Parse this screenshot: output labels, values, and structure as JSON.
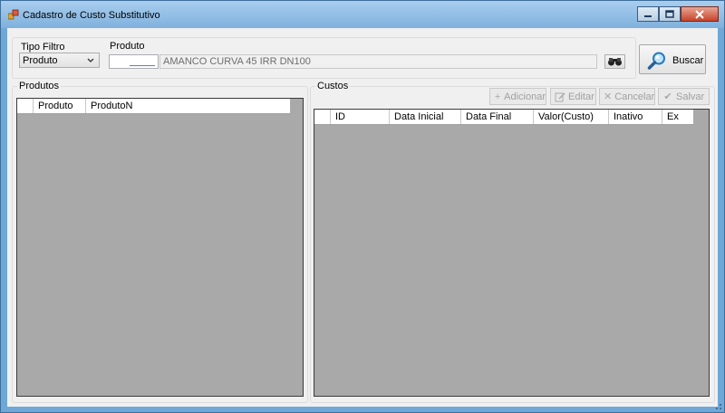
{
  "window": {
    "title": "Cadastro de Custo Substitutivo"
  },
  "filter": {
    "tipo_filtro_label": "Tipo Filtro",
    "tipo_filtro_value": "Produto",
    "produto_label": "Produto",
    "produto_code_value": "",
    "produto_description_value": "AMANCO CURVA 45 IRR DN100",
    "buscar_label": "Buscar"
  },
  "produtos_panel": {
    "title": "Produtos",
    "columns": [
      "",
      "Produto",
      "ProdutoN"
    ]
  },
  "custos_panel": {
    "title": "Custos",
    "toolbar": {
      "adicionar_label": "Adicionar",
      "editar_label": "Editar",
      "cancelar_label": "Cancelar",
      "salvar_label": "Salvar"
    },
    "columns": [
      "",
      "ID",
      "Data Inicial",
      "Data Final",
      "Valor(Custo)",
      "Inativo",
      "Ex"
    ]
  },
  "icons": {
    "app": "app-icon",
    "minimize": "minimize-icon",
    "maximize": "maximize-icon",
    "close": "close-icon",
    "dropdown": "chevron-down-icon",
    "binoculars": "binoculars-icon",
    "search": "magnifier-icon",
    "add": "plus-icon",
    "edit": "edit-icon",
    "cancel": "x-icon",
    "save": "checkmark-icon"
  },
  "colors": {
    "title_bar": "#7fb1dd",
    "client_bg": "#f0f0f0",
    "grid_bg": "#a9a9a9",
    "close_button": "#c7432a",
    "disabled_text": "#a0a0a0"
  }
}
